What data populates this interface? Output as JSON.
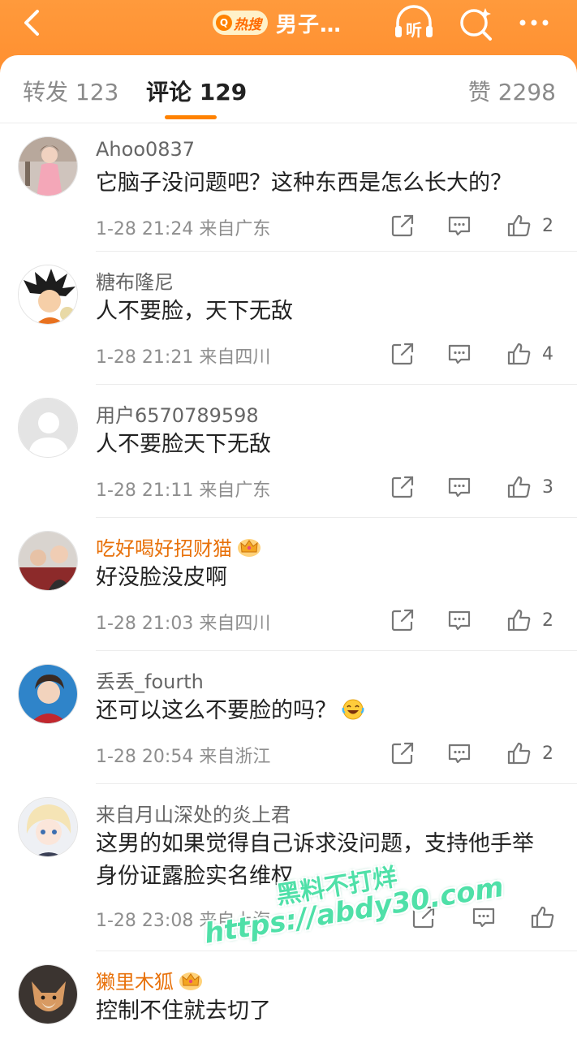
{
  "header": {
    "badge": "热搜",
    "title": "男子…",
    "colors": {
      "accent": "#ff8200",
      "header_bg": "#ff9a3c"
    }
  },
  "tabs": [
    {
      "label": "转发 123",
      "active": false
    },
    {
      "label": "评论 129",
      "active": true
    },
    {
      "label": "赞 2298",
      "active": false
    }
  ],
  "comments": [
    {
      "user": "Ahoo0837",
      "vip": false,
      "text": "它脑子没问题吧？这种东西是怎么长大的？",
      "meta": "1-28 21:24  来自广东",
      "likes": "2",
      "avatar": "avatar-girl-dress"
    },
    {
      "user": "糖布隆尼",
      "vip": false,
      "text": "人不要脸，天下无敌",
      "meta": "1-28 21:21  来自四川",
      "likes": "4",
      "avatar": "avatar-anime-boy"
    },
    {
      "user": "用户6570789598",
      "vip": false,
      "text": "人不要脸天下无敌",
      "meta": "1-28 21:11  来自广东",
      "likes": "3",
      "avatar": "avatar-default"
    },
    {
      "user": "吃好喝好招财猫",
      "vip": true,
      "text": "好没脸没皮啊",
      "meta": "1-28 21:03  来自四川",
      "likes": "2",
      "avatar": "avatar-group-photo"
    },
    {
      "user": "丢丢_fourth",
      "vip": false,
      "text": "还可以这么不要脸的吗？",
      "emoji": "laughing-tears-emoji",
      "meta": "1-28 20:54  来自浙江",
      "likes": "2",
      "avatar": "avatar-boy-blue"
    },
    {
      "user": "来自月山深处的炎上君",
      "vip": false,
      "text": "这男的如果觉得自己诉求没问题，支持他手举身份证露脸实名维权",
      "meta": "1-28 23:08  来自上海",
      "likes": "",
      "avatar": "avatar-anime-blonde"
    },
    {
      "user": "獭里木狐",
      "vip": true,
      "text": "控制不住就去切了",
      "meta": "",
      "likes": "",
      "avatar": "avatar-fox"
    }
  ],
  "watermark": {
    "line1": "黑料不打烊",
    "line2": "https://abdy30.com"
  }
}
